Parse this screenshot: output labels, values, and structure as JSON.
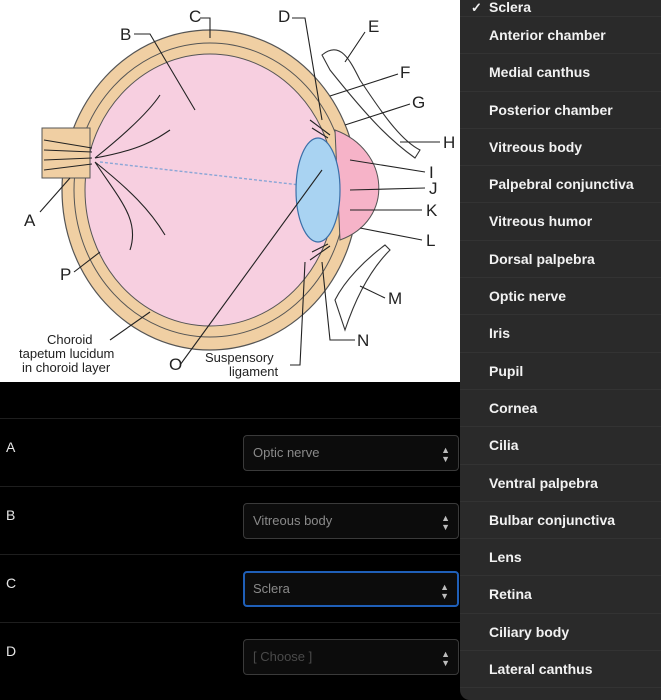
{
  "diagram": {
    "labels": {
      "A": "A",
      "B": "B",
      "C": "C",
      "D": "D",
      "E": "E",
      "F": "F",
      "G": "G",
      "H": "H",
      "I": "I",
      "J": "J",
      "K": "K",
      "L": "L",
      "M": "M",
      "N": "N",
      "O": "O",
      "P": "P"
    },
    "choroid_text": [
      "Choroid",
      "tapetum lucidum",
      "in choroid layer"
    ],
    "suspensory_text": [
      "Suspensory",
      "ligament"
    ]
  },
  "rows": [
    {
      "label": "A",
      "value": "Optic nerve"
    },
    {
      "label": "B",
      "value": "Vitreous body"
    },
    {
      "label": "C",
      "value": "Sclera"
    },
    {
      "label": "D",
      "value": "[ Choose ]"
    }
  ],
  "dropdown": {
    "selected_check": "✓",
    "chevron": "⌃⌄",
    "options": [
      "Sclera",
      "Anterior chamber",
      "Medial canthus",
      "Posterior chamber",
      "Vitreous body",
      "Palpebral conjunctiva",
      "Vitreous humor",
      "Dorsal palpebra",
      "Optic nerve",
      "Iris",
      "Pupil",
      "Cornea",
      "Cilia",
      "Ventral palpebra",
      "Bulbar conjunctiva",
      "Lens",
      "Retina",
      "Ciliary body",
      "Lateral canthus"
    ]
  },
  "colors": {
    "sclera": "#f0cfa3",
    "vitreous": "#f7cfe0",
    "lens": "#a9d3f2",
    "focus": "#1f5fb8"
  }
}
